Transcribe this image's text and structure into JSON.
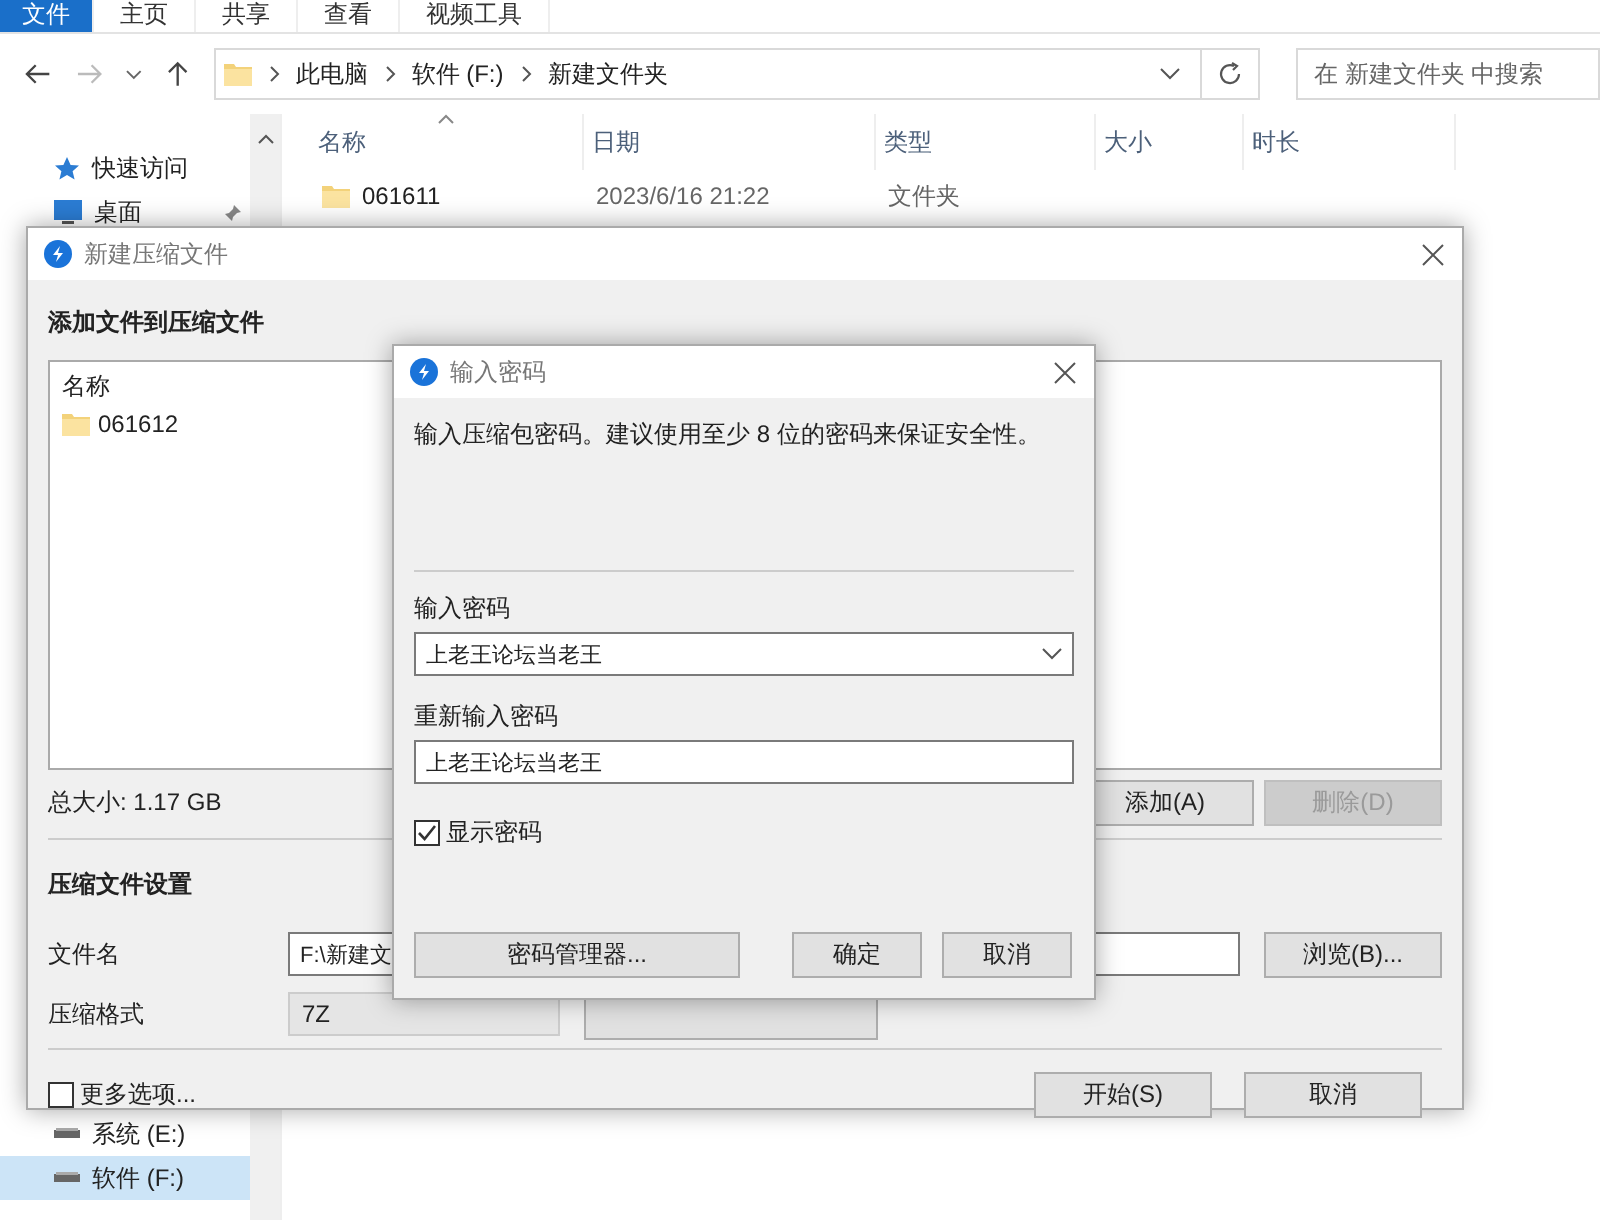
{
  "explorer": {
    "ribbon_tabs": [
      {
        "label": "文件",
        "selected": true
      },
      {
        "label": "主页",
        "selected": false
      },
      {
        "label": "共享",
        "selected": false
      },
      {
        "label": "查看",
        "selected": false
      },
      {
        "label": "视频工具",
        "selected": false
      }
    ],
    "address": {
      "path": [
        "此电脑",
        "软件 (F:)",
        "新建文件夹"
      ]
    },
    "search": {
      "placeholder": "在 新建文件夹 中搜索"
    },
    "nav": {
      "quick_access": [
        {
          "label": "快速访问",
          "kind": "star",
          "pinned": false,
          "selected": false
        },
        {
          "label": "桌面",
          "kind": "desktop",
          "pinned": true,
          "selected": false
        }
      ],
      "drives": [
        {
          "label": "系统 (E:)",
          "kind": "drive",
          "pinned": false,
          "selected": false
        },
        {
          "label": "软件 (F:)",
          "kind": "drive",
          "pinned": false,
          "selected": true
        }
      ]
    },
    "columns": [
      "名称",
      "日期",
      "类型",
      "大小",
      "时长"
    ],
    "rows": [
      {
        "name": "061611",
        "date": "2023/6/16 21:22",
        "type": "文件夹"
      }
    ]
  },
  "compress_dialog": {
    "title": "新建压缩文件",
    "section_title": "添加文件到压缩文件",
    "list_header": "名称",
    "files": [
      {
        "name": "061612"
      }
    ],
    "total_size": "总大小: 1.17 GB",
    "list_buttons": [
      {
        "label": "添加(A)",
        "disabled": false
      },
      {
        "label": "删除(D)",
        "disabled": true
      }
    ],
    "settings_title": "压缩文件设置",
    "filename_label": "文件名",
    "filename_value": "F:\\新建文",
    "browse_button": "浏览(B)...",
    "format_label": "压缩格式",
    "format_value": "7Z",
    "more_options": {
      "label": "更多选项...",
      "checked": false
    },
    "start_button": "开始(S)",
    "cancel_button": "取消"
  },
  "password_dialog": {
    "title": "输入密码",
    "message": "输入压缩包密码。建议使用至少 8 位的密码来保证安全性。",
    "password_label": "输入密码",
    "password_value": "上老王论坛当老王",
    "confirm_label": "重新输入密码",
    "confirm_value": "上老王论坛当老王",
    "show_password": {
      "label": "显示密码",
      "checked": true
    },
    "manager_button": "密码管理器...",
    "ok_button": "确定",
    "cancel_button": "取消"
  }
}
